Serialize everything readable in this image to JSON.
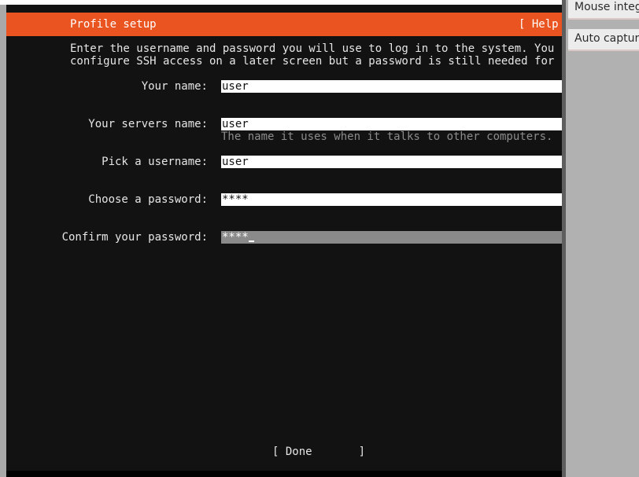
{
  "header": {
    "title": "Profile setup",
    "help_label": "[ Help"
  },
  "intro": {
    "line1": "Enter the username and password you will use to log in to the system. You can",
    "line2": "configure SSH access on a later screen but a password is still needed for sudo."
  },
  "form": {
    "name": {
      "label": "Your name:",
      "value": "user"
    },
    "server_name": {
      "label": "Your servers name:",
      "value": "user",
      "hint": "The name it uses when it talks to other computers."
    },
    "username": {
      "label": "Pick a username:",
      "value": "user"
    },
    "password": {
      "label": "Choose a password:",
      "value": "****"
    },
    "confirm_password": {
      "label": "Confirm your password:",
      "value": "****"
    }
  },
  "footer": {
    "done_label": "[ Done       ]"
  },
  "side_panel": {
    "items": [
      "Mouse integ",
      "Auto capture"
    ]
  },
  "colors": {
    "accent": "#e95420",
    "terminal_bg": "#121212"
  }
}
